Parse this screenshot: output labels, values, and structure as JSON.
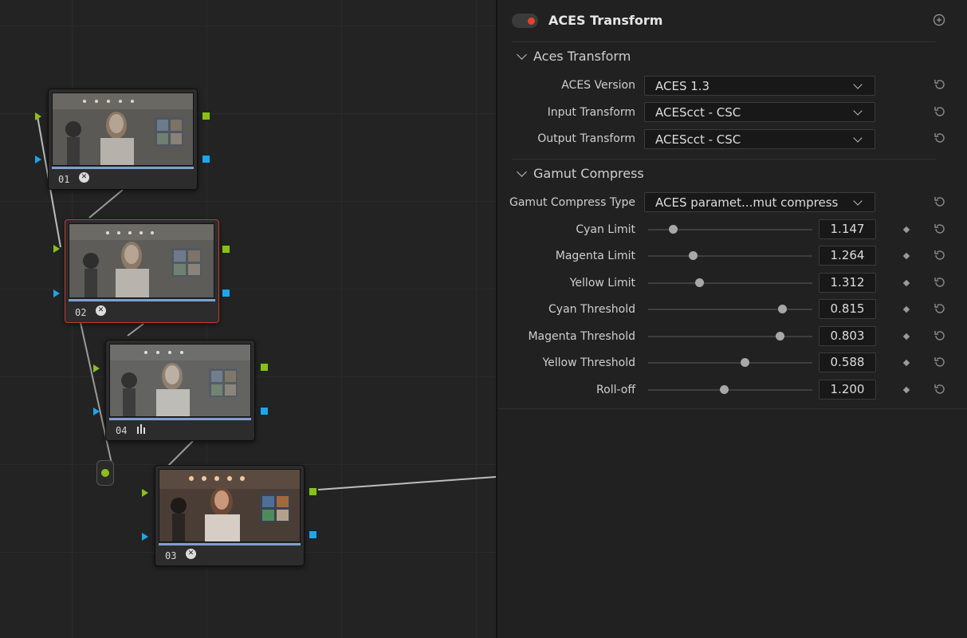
{
  "inspector": {
    "title": "ACES Transform",
    "enabled": true,
    "accent_color": "#e8402b",
    "sections": [
      {
        "title": "Aces Transform",
        "rows": [
          {
            "label": "ACES Version",
            "value": "ACES 1.3"
          },
          {
            "label": "Input Transform",
            "value": "ACEScct - CSC"
          },
          {
            "label": "Output Transform",
            "value": "ACEScct - CSC"
          }
        ]
      },
      {
        "title": "Gamut Compress",
        "dropdown": {
          "label": "Gamut Compress Type",
          "value": "ACES paramet...mut compress"
        },
        "sliders": [
          {
            "label": "Cyan Limit",
            "value": "1.147",
            "level": 0.15
          },
          {
            "label": "Magenta Limit",
            "value": "1.264",
            "level": 0.27
          },
          {
            "label": "Yellow Limit",
            "value": "1.312",
            "level": 0.31
          },
          {
            "label": "Cyan Threshold",
            "value": "0.815",
            "level": 0.815
          },
          {
            "label": "Magenta Threshold",
            "value": "0.803",
            "level": 0.8
          },
          {
            "label": "Yellow Threshold",
            "value": "0.588",
            "level": 0.588
          },
          {
            "label": "Roll-off",
            "value": "1.200",
            "level": 0.46
          }
        ]
      }
    ]
  },
  "nodes": [
    {
      "number": "01",
      "icon": "aces-fx-icon",
      "selected": false
    },
    {
      "number": "02",
      "icon": "aces-fx-icon",
      "selected": true
    },
    {
      "number": "04",
      "icon": "bars-icon",
      "selected": false
    },
    {
      "number": "03",
      "icon": "aces-fx-icon",
      "selected": false
    }
  ],
  "colors": {
    "port_rgb_green": "#8cbf1b",
    "port_alpha_blue": "#1ea7e6",
    "selection_red": "#c4392d",
    "node_bar_blue": "#7f9fcf"
  }
}
